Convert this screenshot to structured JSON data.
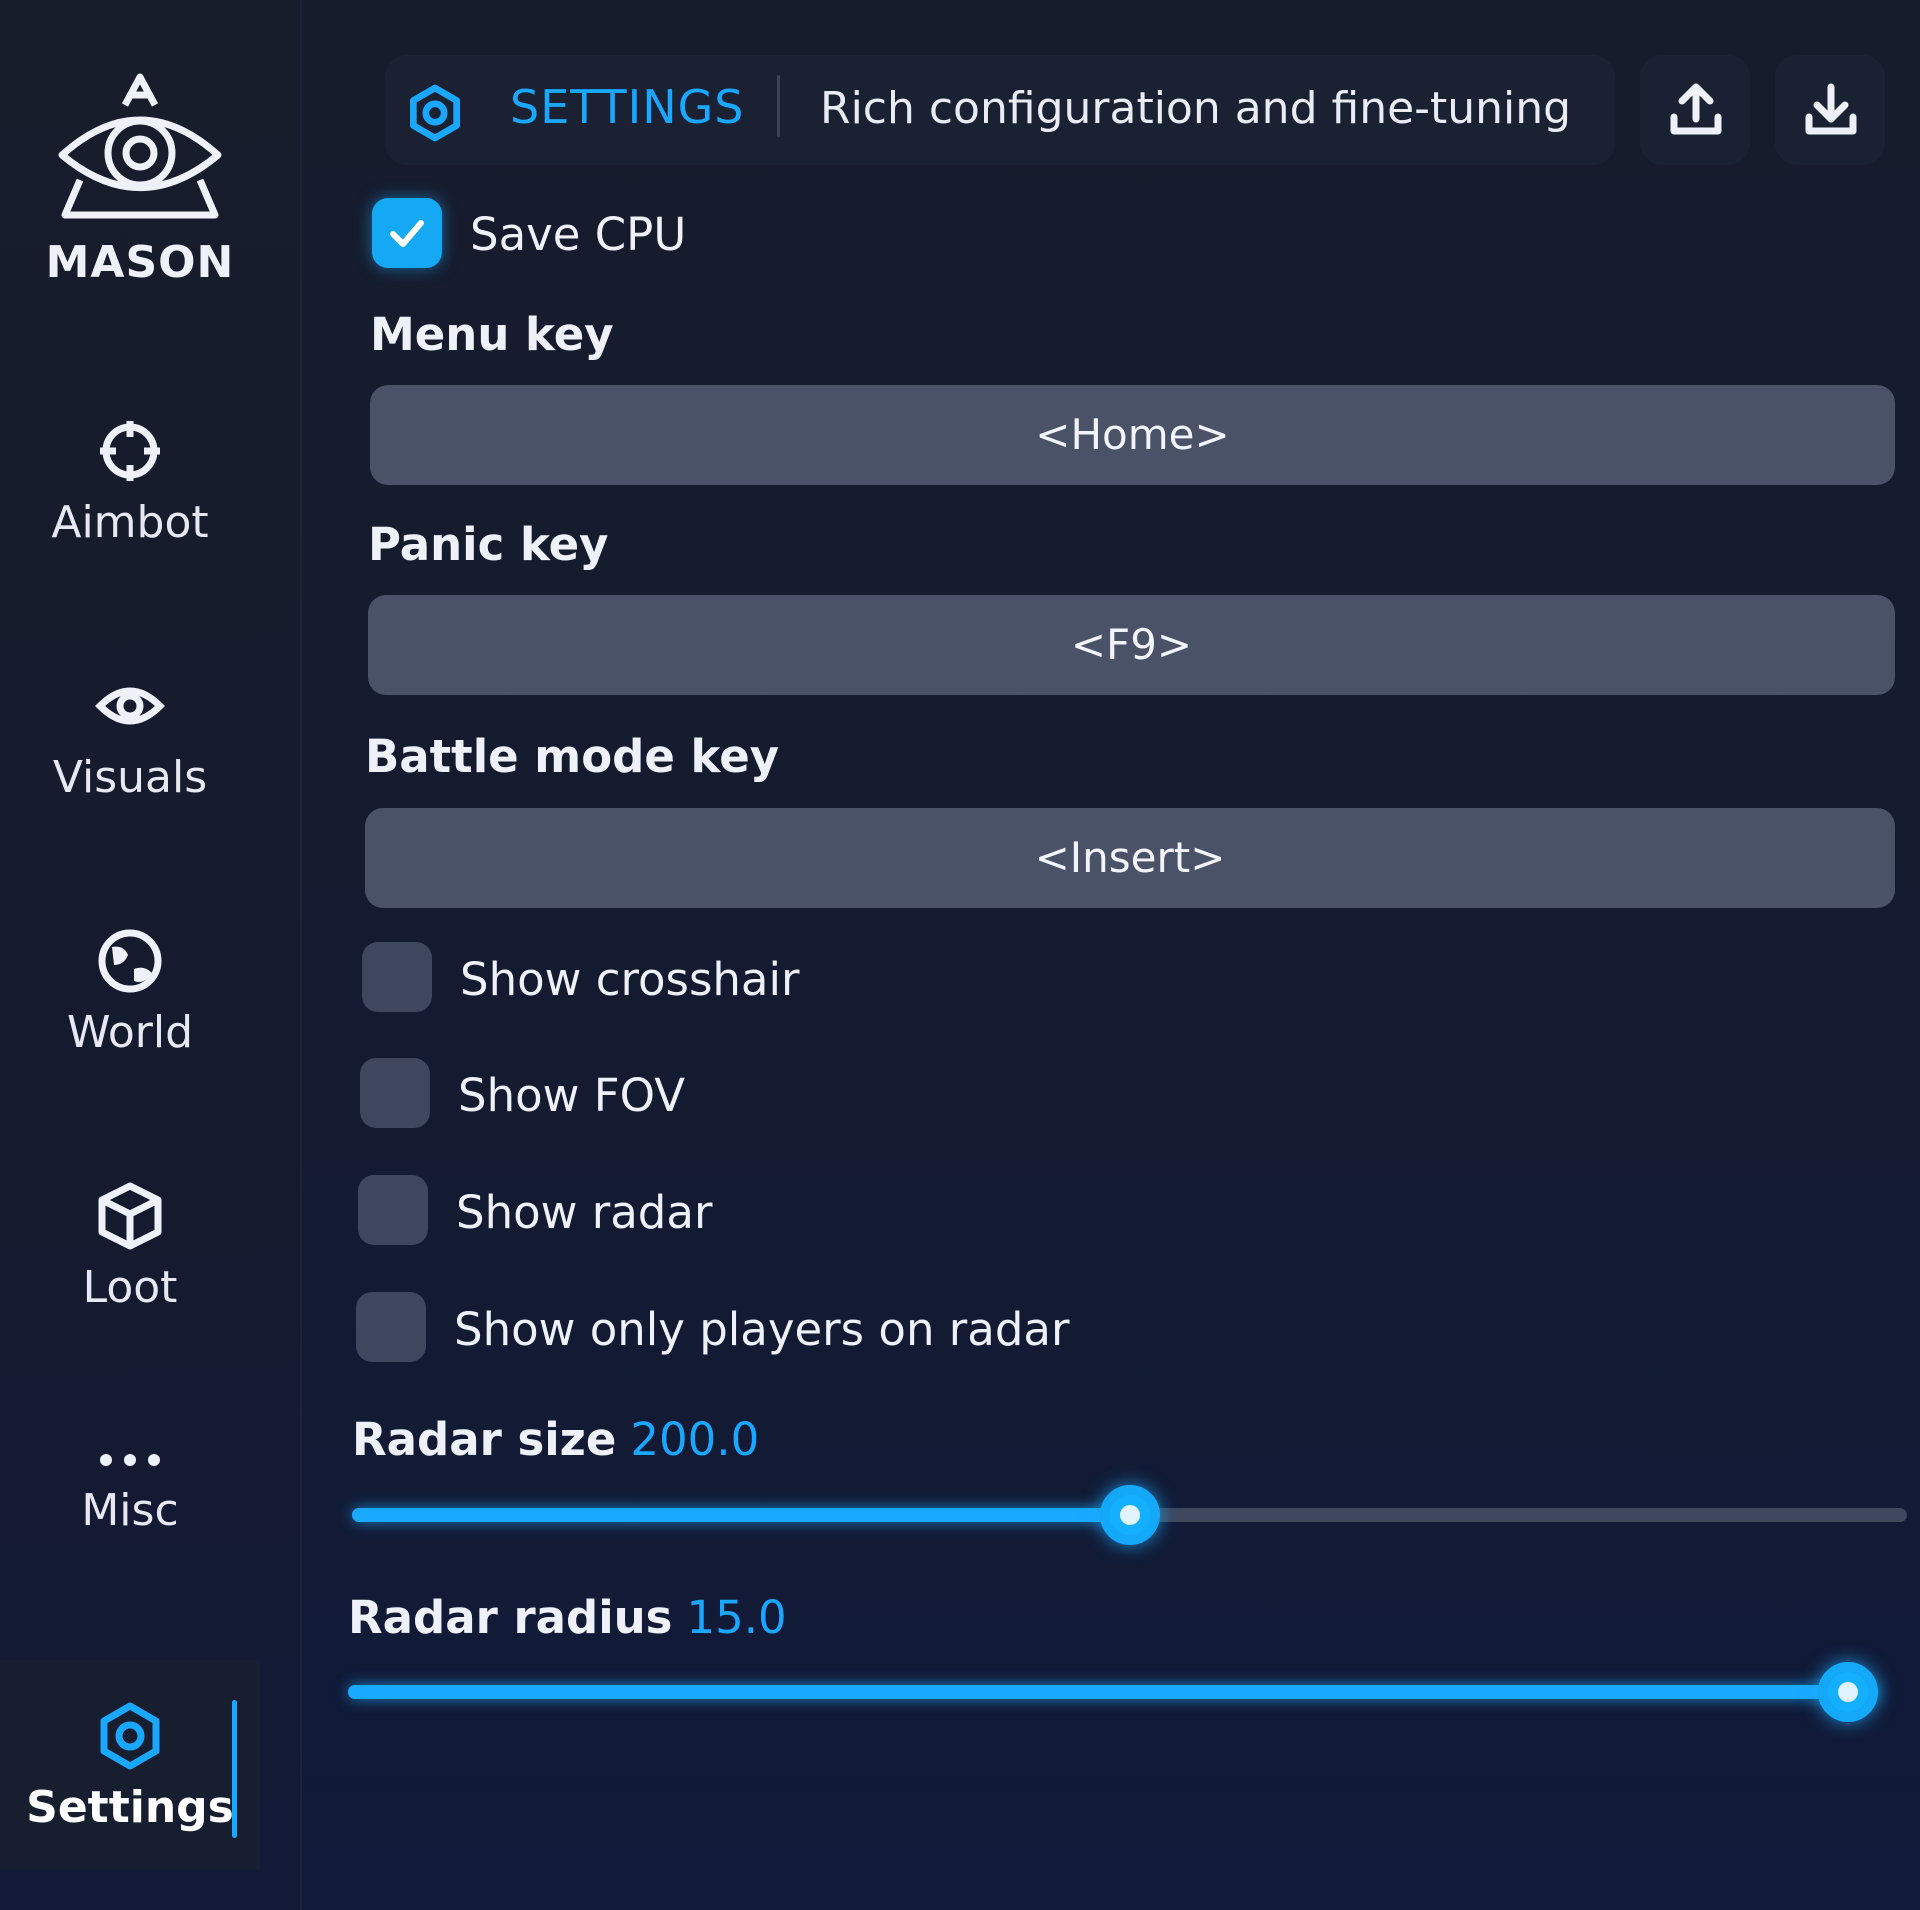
{
  "sidebar": {
    "logo_text": "MASON",
    "items": [
      {
        "label": "Aimbot",
        "icon": "crosshair-icon"
      },
      {
        "label": "Visuals",
        "icon": "eye-icon"
      },
      {
        "label": "World",
        "icon": "globe-icon"
      },
      {
        "label": "Loot",
        "icon": "cube-icon"
      },
      {
        "label": "Misc",
        "icon": "ellipsis-icon"
      },
      {
        "label": "Settings",
        "icon": "gear-icon"
      }
    ],
    "active": "Settings"
  },
  "header": {
    "title": "SETTINGS",
    "subtitle": "Rich configuration and fine-tuning",
    "upload_icon": "upload-icon",
    "download_icon": "download-icon"
  },
  "settings": {
    "save_cpu": {
      "label": "Save CPU",
      "checked": true
    },
    "menu_key": {
      "label": "Menu key",
      "value": "<Home>"
    },
    "panic_key": {
      "label": "Panic key",
      "value": "<F9>"
    },
    "battle_mode_key": {
      "label": "Battle mode key",
      "value": "<Insert>"
    },
    "show_crosshair": {
      "label": "Show crosshair",
      "checked": false
    },
    "show_fov": {
      "label": "Show FOV",
      "checked": false
    },
    "show_radar": {
      "label": "Show radar",
      "checked": false
    },
    "show_only_players": {
      "label": "Show only players on radar",
      "checked": false
    },
    "radar_size": {
      "label": "Radar size",
      "value": "200.0",
      "fraction": 0.5
    },
    "radar_radius": {
      "label": "Radar radius",
      "value": "15.0",
      "fraction": 1.0
    }
  },
  "colors": {
    "accent": "#1aa7ff",
    "background": "#141b2e",
    "control": "#4a5267"
  }
}
